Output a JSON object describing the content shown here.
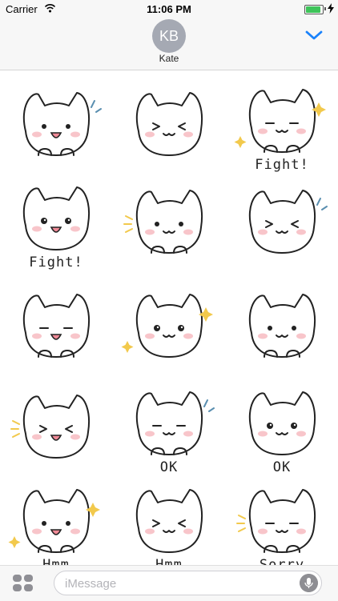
{
  "status_bar": {
    "carrier": "Carrier",
    "time": "11:06 PM",
    "battery_percent": 90
  },
  "header": {
    "avatar_initials": "KB",
    "contact_name": "Kate"
  },
  "stickers": [
    {
      "label": ""
    },
    {
      "label": ""
    },
    {
      "label": "Fight!"
    },
    {
      "label": "Fight!"
    },
    {
      "label": ""
    },
    {
      "label": ""
    },
    {
      "label": ""
    },
    {
      "label": ""
    },
    {
      "label": ""
    },
    {
      "label": ""
    },
    {
      "label": "OK"
    },
    {
      "label": "OK"
    },
    {
      "label": "Hmm"
    },
    {
      "label": "Hmm"
    },
    {
      "label": "Sorry"
    }
  ],
  "input_bar": {
    "placeholder": "iMessage"
  },
  "colors": {
    "accent": "#1a82fb",
    "avatar_bg": "#a5a9b3",
    "blush": "#f6b6bd",
    "sparkle": "#f2c94c",
    "sweat": "#5a8fb0"
  }
}
